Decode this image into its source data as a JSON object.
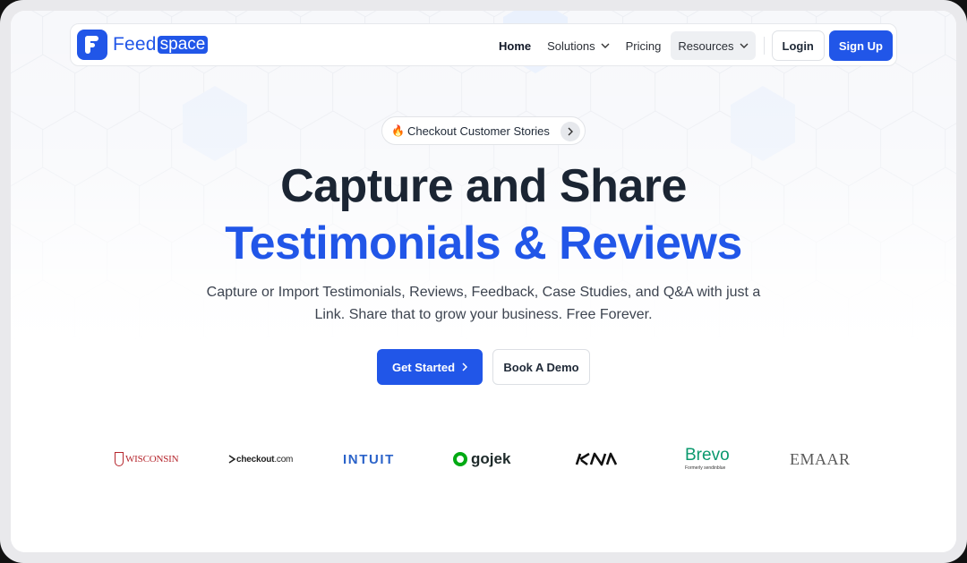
{
  "brand": {
    "name_part1": "Feed",
    "name_part2": "space",
    "color": "#2156e8"
  },
  "nav": {
    "links": [
      {
        "label": "Home",
        "active": true
      },
      {
        "label": "Solutions",
        "has_dropdown": true
      },
      {
        "label": "Pricing"
      },
      {
        "label": "Resources",
        "has_dropdown": true,
        "highlighted": true
      }
    ],
    "login_label": "Login",
    "signup_label": "Sign Up"
  },
  "hero": {
    "pill": {
      "icon": "fire-icon",
      "label": "Checkout Customer Stories"
    },
    "headline_line1": "Capture and Share",
    "headline_line2": "Testimonials & Reviews",
    "subtitle_line1": "Capture or Import Testimonials, Reviews, Feedback, Case Studies, and Q&A with just a",
    "subtitle_line2": "Link. Share that to grow your business. Free Forever.",
    "primary_cta": "Get Started",
    "secondary_cta": "Book A Demo"
  },
  "customer_logos": [
    {
      "name": "WISCONSIN"
    },
    {
      "name": "checkout",
      "suffix": ".com"
    },
    {
      "name": "INTUIT"
    },
    {
      "name": "gojek"
    },
    {
      "name": "KIA"
    },
    {
      "name": "Brevo",
      "tagline": "Formerly sendinblue"
    },
    {
      "name": "EMAAR"
    }
  ],
  "colors": {
    "accent": "#2156e8",
    "heading": "#1b2533",
    "body_text": "#3d4450"
  }
}
